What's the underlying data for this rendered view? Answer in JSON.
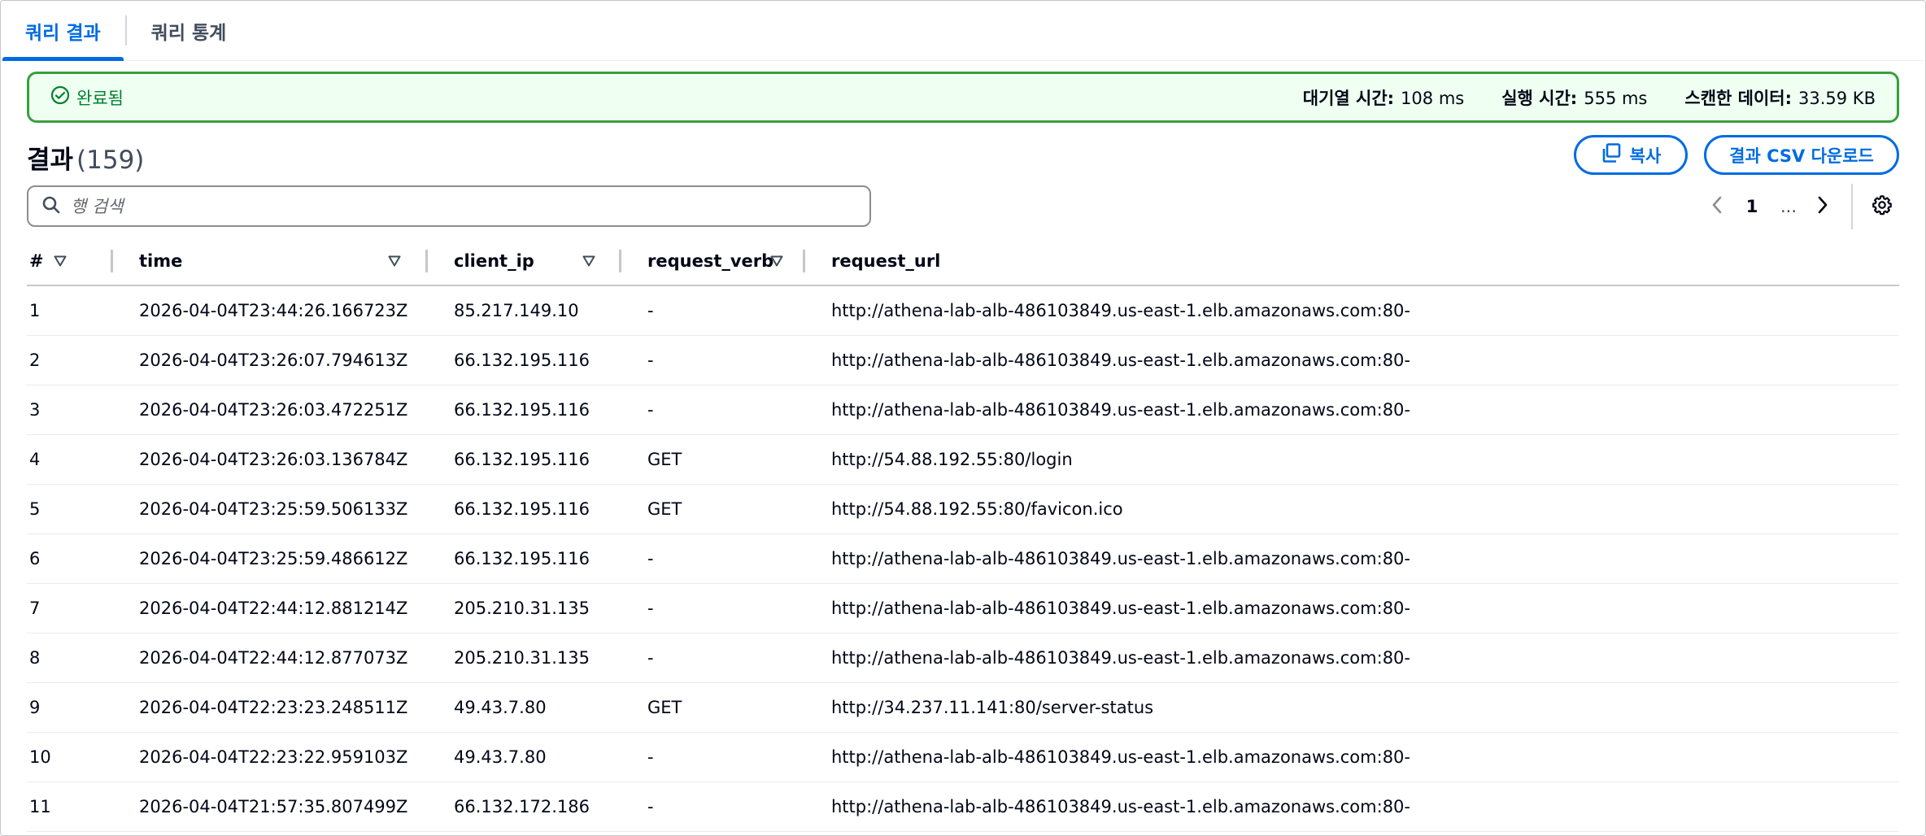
{
  "tabs": [
    {
      "label": "쿼리 결과",
      "active": true
    },
    {
      "label": "쿼리 통계",
      "active": false
    }
  ],
  "status": {
    "label": "완료됨",
    "queue_time_label": "대기열 시간:",
    "queue_time_value": "108 ms",
    "run_time_label": "실행 시간:",
    "run_time_value": "555 ms",
    "scanned_label": "스캔한 데이터:",
    "scanned_value": "33.59 KB",
    "color": "#37a03b"
  },
  "results": {
    "title": "결과",
    "count": "(159)",
    "copy_label": "복사",
    "csv_label": "결과 CSV 다운로드"
  },
  "search": {
    "placeholder": "행 검색",
    "value": ""
  },
  "pagination": {
    "current": "1",
    "ellipsis": "..."
  },
  "table": {
    "columns": [
      "#",
      "time",
      "client_ip",
      "request_verb",
      "request_url"
    ],
    "rows": [
      [
        "1",
        "2026-04-04T23:44:26.166723Z",
        "85.217.149.10",
        "-",
        "http://athena-lab-alb-486103849.us-east-1.elb.amazonaws.com:80-"
      ],
      [
        "2",
        "2026-04-04T23:26:07.794613Z",
        "66.132.195.116",
        "-",
        "http://athena-lab-alb-486103849.us-east-1.elb.amazonaws.com:80-"
      ],
      [
        "3",
        "2026-04-04T23:26:03.472251Z",
        "66.132.195.116",
        "-",
        "http://athena-lab-alb-486103849.us-east-1.elb.amazonaws.com:80-"
      ],
      [
        "4",
        "2026-04-04T23:26:03.136784Z",
        "66.132.195.116",
        "GET",
        "http://54.88.192.55:80/login"
      ],
      [
        "5",
        "2026-04-04T23:25:59.506133Z",
        "66.132.195.116",
        "GET",
        "http://54.88.192.55:80/favicon.ico"
      ],
      [
        "6",
        "2026-04-04T23:25:59.486612Z",
        "66.132.195.116",
        "-",
        "http://athena-lab-alb-486103849.us-east-1.elb.amazonaws.com:80-"
      ],
      [
        "7",
        "2026-04-04T22:44:12.881214Z",
        "205.210.31.135",
        "-",
        "http://athena-lab-alb-486103849.us-east-1.elb.amazonaws.com:80-"
      ],
      [
        "8",
        "2026-04-04T22:44:12.877073Z",
        "205.210.31.135",
        "-",
        "http://athena-lab-alb-486103849.us-east-1.elb.amazonaws.com:80-"
      ],
      [
        "9",
        "2026-04-04T22:23:23.248511Z",
        "49.43.7.80",
        "GET",
        "http://34.237.11.141:80/server-status"
      ],
      [
        "10",
        "2026-04-04T22:23:22.959103Z",
        "49.43.7.80",
        "-",
        "http://athena-lab-alb-486103849.us-east-1.elb.amazonaws.com:80-"
      ],
      [
        "11",
        "2026-04-04T21:57:35.807499Z",
        "66.132.172.186",
        "-",
        "http://athena-lab-alb-486103849.us-east-1.elb.amazonaws.com:80-"
      ]
    ]
  },
  "icons": {
    "status": "check-circle-icon",
    "copy": "copy-icon",
    "search": "search-icon",
    "prev": "chevron-left-icon",
    "next": "chevron-right-icon",
    "settings": "gear-icon",
    "sort": "sort-triangle-icon"
  }
}
